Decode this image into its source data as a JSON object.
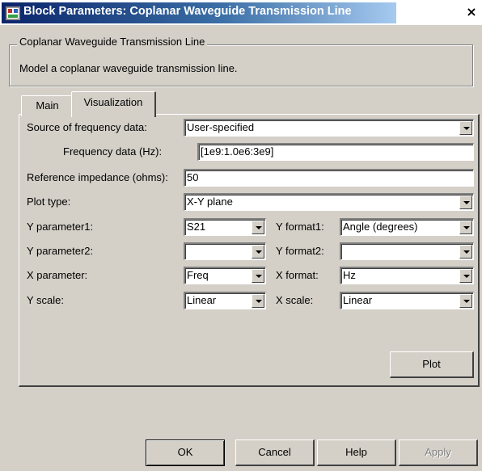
{
  "window": {
    "title": "Block Parameters: Coplanar Waveguide Transmission Line",
    "close_symbol": "×"
  },
  "group": {
    "legend": "Coplanar Waveguide Transmission Line",
    "description": "Model a coplanar waveguide transmission line."
  },
  "tabs": [
    {
      "label": "Main",
      "active": false
    },
    {
      "label": "Visualization",
      "active": true
    }
  ],
  "form": {
    "source_label": "Source of frequency data:",
    "source_value": "User-specified",
    "freq_label": "Frequency data (Hz):",
    "freq_value": "[1e9:1.0e6:3e9]",
    "ref_label": "Reference impedance (ohms):",
    "ref_value": "50",
    "plot_type_label": "Plot type:",
    "plot_type_value": "X-Y plane",
    "yparam1_label": "Y parameter1:",
    "yparam1_value": "S21",
    "yformat1_label": "Y format1:",
    "yformat1_value": "Angle (degrees)",
    "yparam2_label": "Y parameter2:",
    "yparam2_value": "",
    "yformat2_label": "Y format2:",
    "yformat2_value": "",
    "xparam_label": "X parameter:",
    "xparam_value": "Freq",
    "xformat_label": "X format:",
    "xformat_value": "Hz",
    "yscale_label": "Y scale:",
    "yscale_value": "Linear",
    "xscale_label": "X scale:",
    "xscale_value": "Linear"
  },
  "buttons": {
    "plot": "Plot",
    "ok": "OK",
    "cancel": "Cancel",
    "help": "Help",
    "apply": "Apply"
  },
  "colors": {
    "title_bar_start": "#0a246a",
    "title_bar_end": "#a6caf0",
    "dialog_face": "#d4d0c8"
  },
  "icons": {
    "title": "simulink-block-icon",
    "close": "close-icon",
    "dropdown": "chevron-down-icon"
  }
}
